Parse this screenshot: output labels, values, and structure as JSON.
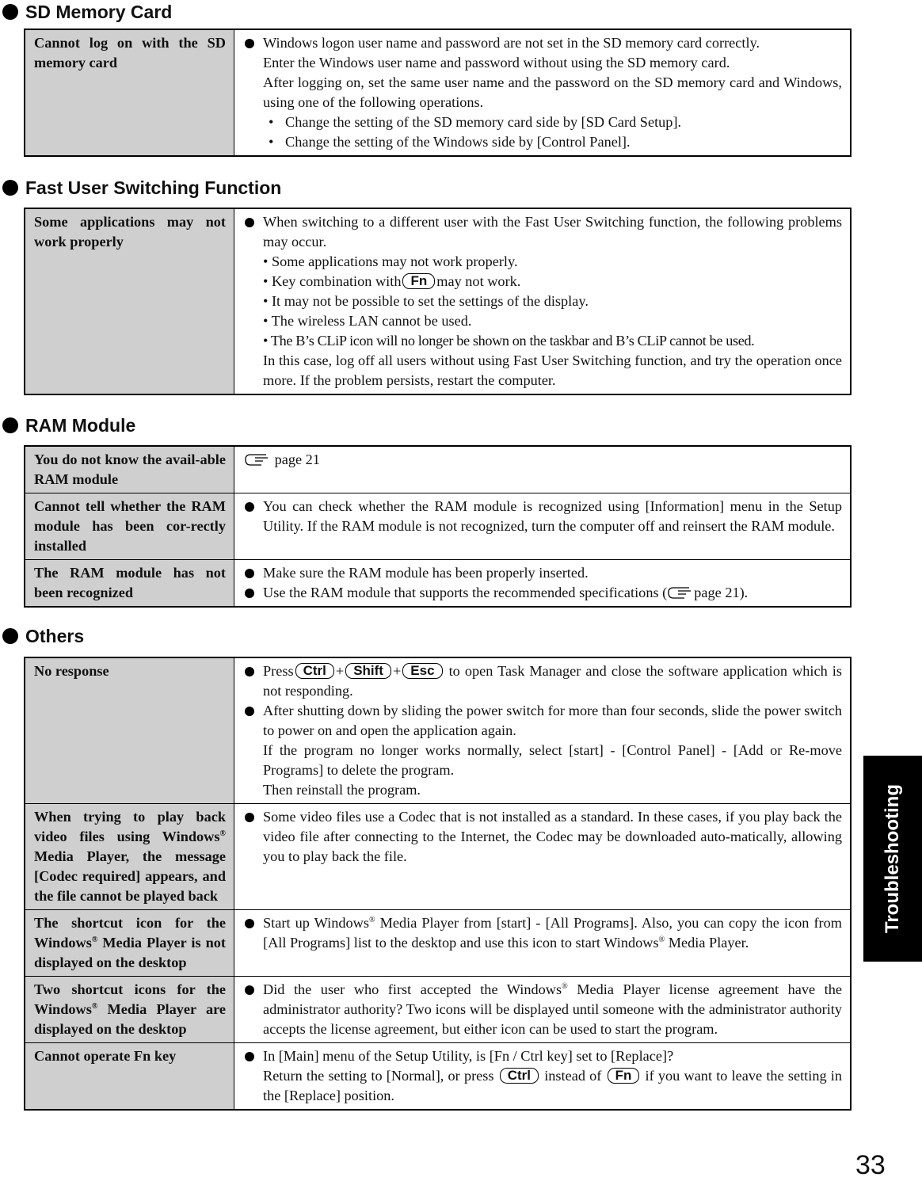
{
  "sections": [
    {
      "title": "SD Memory Card",
      "rows": [
        {
          "problem": "Cannot log on with the SD memory card",
          "solution": {
            "bullet": "Windows logon user name and password are not set in the SD memory card correctly.",
            "lines": [
              "Enter the Windows user name and password without using the SD memory card.",
              "After logging on, set the same user name and the password on the SD memory card and Windows, using one of the following operations."
            ],
            "sub_items": [
              "Change the setting of the SD memory card side by [SD Card Setup].",
              "Change the setting of the Windows side by [Control Panel]."
            ]
          }
        }
      ]
    },
    {
      "title": "Fast User Switching Function",
      "rows": [
        {
          "problem": "Some applications may not work properly",
          "solution": {
            "bullet": "When switching to a different user with the Fast User Switching function, the following problems may occur.",
            "items": [
              "• Some applications may not work properly.",
              "• Key combination with",
              "may not work.",
              "• It may not be possible to set the settings of the display.",
              "• The wireless LAN cannot be used.",
              "• The B’s CLiP icon will no longer be shown on the taskbar and B’s CLiP cannot be used."
            ],
            "key": "Fn",
            "closing": "In this case, log off all users without using Fast User Switching function, and try the operation once more. If the problem persists, restart the computer."
          }
        }
      ]
    },
    {
      "title": "RAM Module",
      "rows": [
        {
          "problem": "You do not know the avail-able RAM module",
          "solution": {
            "ref": "page 21"
          }
        },
        {
          "problem": "Cannot tell whether the RAM module has been cor-rectly installed",
          "solution": {
            "bullet": "You can check whether the RAM module is recognized using [Information] menu in the Setup Utility. If the RAM module is not recognized, turn the computer off and reinsert the RAM module."
          }
        },
        {
          "problem": "The RAM module has not been recognized",
          "solution": {
            "bullets": [
              "Make sure the RAM module has been properly inserted.",
              "Use the RAM module that supports the recommended specifications ("
            ],
            "ref_tail": "page 21)."
          }
        }
      ]
    },
    {
      "title": "Others",
      "rows": [
        {
          "problem": "No response",
          "solution": {
            "press": "Press",
            "keys": [
              "Ctrl",
              "Shift",
              "Esc"
            ],
            "plus": "+",
            "bullet1_tail": "to open Task Manager and close the software application which is not responding.",
            "bullet2": "After shutting down by sliding the power switch for more than four seconds, slide the power switch to power on and open the application again.",
            "lines": [
              "If the program no longer works normally, select [start] - [Control Panel] - [Add or Re-move Programs] to delete the program.",
              "Then reinstall the program."
            ]
          }
        },
        {
          "problem_parts": [
            "When trying to play back video files using Windows",
            "®",
            " Media Player, the message [Codec required] appears, and the file cannot be played back"
          ],
          "solution": {
            "bullet": "Some video files use a Codec that is not installed as a standard. In these cases, if you play back the video file after connecting to the Internet, the Codec may be downloaded auto-matically, allowing you to play back the file."
          }
        },
        {
          "problem_parts": [
            "The shortcut icon for the Windows",
            "®",
            " Media Player is not displayed on the desktop"
          ],
          "solution": {
            "parts": [
              "Start up Windows",
              "®",
              " Media Player from [start] - [All Programs]. Also, you can copy the icon from [All Programs] list to the desktop and use this icon to start Windows",
              "®",
              " Media Player."
            ]
          }
        },
        {
          "problem_parts": [
            "Two shortcut icons for the Windows",
            "®",
            " Media Player are displayed on the desktop"
          ],
          "solution": {
            "parts": [
              "Did the user who first accepted the Windows",
              "®",
              " Media Player license agreement have the administrator authority? Two icons will be displayed until someone with the administrator authority accepts the license agreement, but either icon can be used to start the program."
            ]
          }
        },
        {
          "problem": "Cannot operate Fn key",
          "solution": {
            "bullet": "In [Main] menu of the Setup Utility, is [Fn / Ctrl key] set to [Replace]?",
            "line_a": "Return the setting to [Normal], or press",
            "key1": "Ctrl",
            "line_b": "instead of",
            "key2": "Fn",
            "line_c": "if you want to leave the setting in the [Replace] position."
          }
        }
      ]
    }
  ],
  "side_tab": "Troubleshooting",
  "page_number": "33"
}
